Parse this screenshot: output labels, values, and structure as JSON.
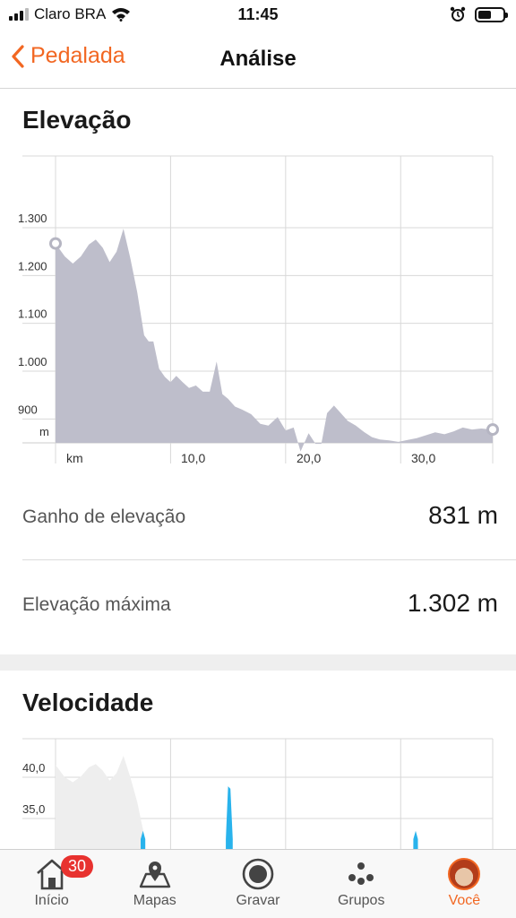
{
  "status_bar": {
    "carrier": "Claro BRA",
    "time": "11:45",
    "battery_level": 0.55
  },
  "nav": {
    "back_label": "Pedalada",
    "title": "Análise"
  },
  "elevation": {
    "title": "Elevação",
    "gain_label": "Ganho de elevação",
    "gain_value": "831 m",
    "max_label": "Elevação máxima",
    "max_value": "1.302 m"
  },
  "speed": {
    "title": "Velocidade"
  },
  "chart_data": [
    {
      "type": "area",
      "title": "Elevação",
      "xlabel": "km",
      "ylabel": "m",
      "xlim": [
        0,
        38
      ],
      "ylim": [
        850,
        1450
      ],
      "x_ticks": [
        "km",
        "10,0",
        "20,0",
        "30,0"
      ],
      "y_ticks": [
        "1.300",
        "1.200",
        "1.100",
        "1.000",
        "900",
        "m"
      ],
      "grid": true,
      "color": "#bebecb",
      "series": [
        {
          "x": [
            0,
            0.8,
            1.5,
            2.2,
            2.9,
            3.5,
            4.1,
            4.7,
            5.3,
            5.9,
            6.5,
            7.1,
            7.7,
            8.1,
            8.5,
            9,
            9.5,
            10,
            10.5,
            11,
            11.6,
            12.2,
            12.8,
            13.4,
            14,
            14.5,
            15,
            15.6,
            16.2,
            17,
            17.8,
            18.5,
            19.3,
            20,
            20.7,
            21.3,
            22,
            22.6,
            23.1,
            23.6,
            24.2,
            24.8,
            25.4,
            26.1,
            26.8,
            27.5,
            28.2,
            29,
            29.8,
            30.6,
            31.4,
            32.2,
            33,
            33.8,
            34.6,
            35.4,
            36.2,
            37,
            38
          ],
          "y": [
            1267,
            1240,
            1225,
            1240,
            1265,
            1275,
            1258,
            1228,
            1250,
            1298,
            1236,
            1165,
            1075,
            1062,
            1062,
            1005,
            988,
            977,
            990,
            978,
            965,
            970,
            957,
            957,
            1020,
            952,
            942,
            926,
            920,
            910,
            890,
            886,
            904,
            876,
            882,
            832,
            870,
            848,
            848,
            912,
            928,
            912,
            896,
            886,
            873,
            862,
            857,
            855,
            852,
            856,
            860,
            866,
            872,
            868,
            874,
            882,
            878,
            880,
            878
          ]
        }
      ]
    },
    {
      "type": "area",
      "title": "Velocidade",
      "y_ticks": [
        "40,0",
        "35,0"
      ],
      "grid": true,
      "series": [
        {
          "name": "Elevação (fundo)",
          "color": "#eeeeee",
          "x": [
            0,
            0.8,
            1.5,
            2.2,
            2.9,
            3.5,
            4.1,
            4.7,
            5.3,
            5.9,
            6.5,
            7.1,
            7.7
          ],
          "y": [
            41.5,
            40.0,
            39.4,
            40.1,
            41.2,
            41.6,
            40.8,
            39.6,
            40.5,
            42.6,
            40.0,
            37.0,
            33.0
          ]
        },
        {
          "name": "Velocidade",
          "color": "#29b3ec",
          "x": [
            7.4,
            7.6,
            7.8,
            14.8,
            15.0,
            15.2,
            15.4,
            31.1,
            31.3,
            31.5
          ],
          "y": [
            32.5,
            33.5,
            32.5,
            32.5,
            38.9,
            38.6,
            32.5,
            32.5,
            33.5,
            32.5
          ]
        }
      ]
    }
  ],
  "tabs": [
    {
      "label": "Início",
      "icon": "home-icon",
      "badge": "30"
    },
    {
      "label": "Mapas",
      "icon": "map-pin-icon"
    },
    {
      "label": "Gravar",
      "icon": "record-icon"
    },
    {
      "label": "Grupos",
      "icon": "groups-icon"
    },
    {
      "label": "Você",
      "icon": "avatar",
      "active": true
    }
  ],
  "colors": {
    "accent": "#f26722",
    "elevation_fill": "#bebecb",
    "speed_line": "#29b3ec",
    "badge": "#e8322f"
  }
}
